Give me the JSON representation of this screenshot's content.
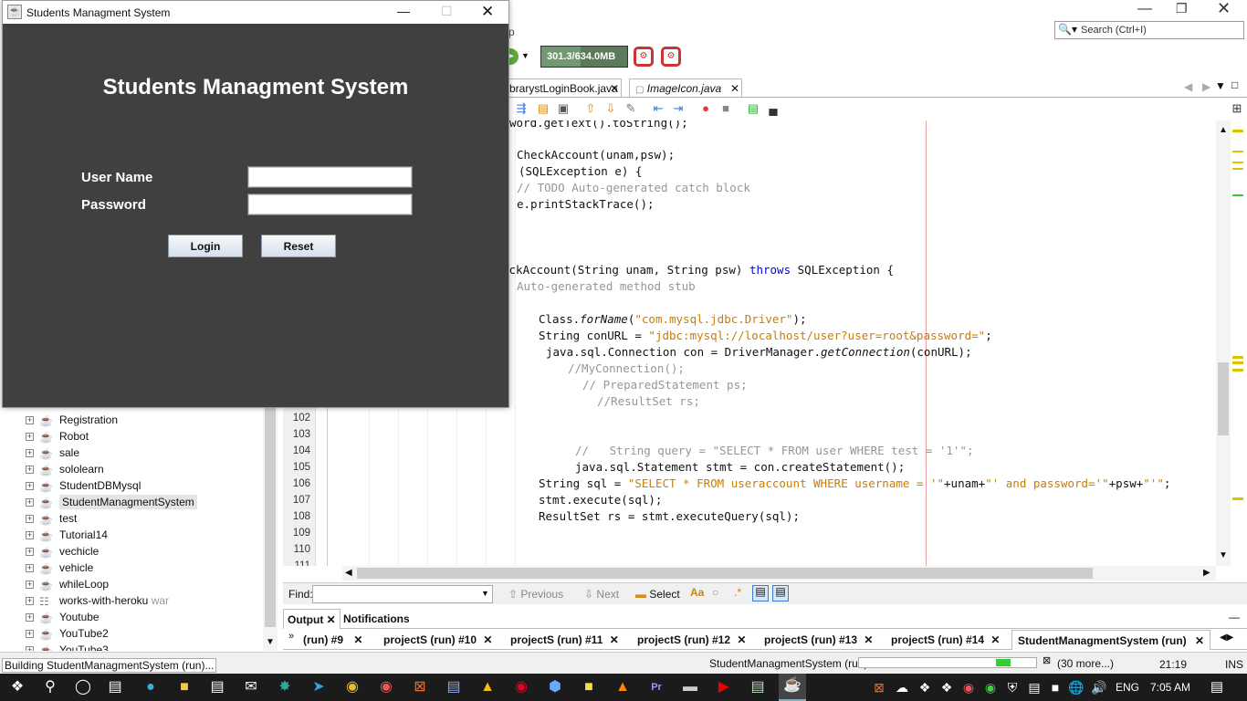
{
  "ide": {
    "search_placeholder": "Search (Ctrl+I)",
    "memory": "301.3/634.0MB",
    "menu_fragment": "p",
    "editor_tabs": [
      {
        "label": "brarystLoginBook.java"
      },
      {
        "label": "ImageIcon.java"
      }
    ],
    "line_numbers": [
      "102",
      "103",
      "104",
      "105",
      "106",
      "107",
      "108",
      "109",
      "110",
      "111"
    ],
    "code": {
      "l0": "word.getText().toString();",
      "l1": "CheckAccount(unam,psw);",
      "l2a": "(SQLException e) {",
      "l3": "// TODO Auto-generated catch block",
      "l4": "e.printStackTrace();",
      "l5a": "eckAccount(String unam, String psw) ",
      "l5kw": "throws",
      "l5b": " SQLException {",
      "l6": "Auto-generated method stub",
      "l7a": "Class.",
      "l7b": "forName",
      "l7c": "(",
      "l7s": "\"com.mysql.jdbc.Driver\"",
      "l7d": ");",
      "l8a": "String conURL = ",
      "l8s": "\"jdbc:mysql://localhost/user?user=root&password=\"",
      "l8b": ";",
      "l9a": "java.sql.Connection con = DriverManager.",
      "l9b": "getConnection",
      "l9c": "(conURL);",
      "l10": "//MyConnection();",
      "l11": "// PreparedStatement ps;",
      "l12": "//ResultSet rs;",
      "l13": "//   String query = \"SELECT * FROM user WHERE test = '1'\";",
      "l14": "java.sql.Statement stmt = con.createStatement();",
      "l15a": "String sql = ",
      "l15s": "\"SELECT * FROM useraccount WHERE username = '\"",
      "l15b": "+unam+",
      "l15s2": "\"' and password='\"",
      "l15c": "+psw+",
      "l15s3": "\"'\"",
      "l15d": ";",
      "l16": "stmt.execute(sql);",
      "l17": "ResultSet rs = stmt.executeQuery(sql);"
    },
    "find": {
      "label": "Find:",
      "previous": "Previous",
      "next": "Next",
      "select": "Select"
    },
    "output_tabs": [
      {
        "label": "Output"
      },
      {
        "label": "Notifications"
      }
    ],
    "run_tabs": [
      "(run) #9",
      "projectS (run) #10",
      "projectS (run) #11",
      "projectS (run) #12",
      "projectS (run) #13",
      "projectS (run) #14",
      "StudentManagmentSystem (run)"
    ],
    "status": {
      "building": "Building StudentManagmentSystem (run)...",
      "running": "StudentManagmentSystem (run)",
      "more": "(30 more...)",
      "position": "21:19",
      "mode": "INS",
      "progress": 0.08
    },
    "projects": [
      {
        "label": "Registration"
      },
      {
        "label": "Robot"
      },
      {
        "label": "sale"
      },
      {
        "label": "sololearn"
      },
      {
        "label": "StudentDBMysql"
      },
      {
        "label": "StudentManagmentSystem"
      },
      {
        "label": "test"
      },
      {
        "label": "Tutorial14"
      },
      {
        "label": "vechicle"
      },
      {
        "label": "vehicle"
      },
      {
        "label": "whileLoop"
      },
      {
        "label": "works-with-heroku",
        "suffix": "war"
      },
      {
        "label": "Youtube"
      },
      {
        "label": "YouTube2"
      },
      {
        "label": "YouTube3"
      }
    ]
  },
  "dialog": {
    "title": "Students Managment System",
    "heading": "Students Managment System",
    "username_label": "User Name",
    "password_label": "Password",
    "username_value": "",
    "password_value": "",
    "login_label": "Login",
    "reset_label": "Reset"
  },
  "taskbar": {
    "lang": "ENG",
    "time": "7:05 AM"
  },
  "colors": {
    "dialog_bg": "#404040",
    "ide_bg": "#ffffff",
    "taskbar_bg": "#1b1b1b",
    "string": "#ce7b00",
    "comment": "#969696",
    "keyword": "#0000e6"
  }
}
